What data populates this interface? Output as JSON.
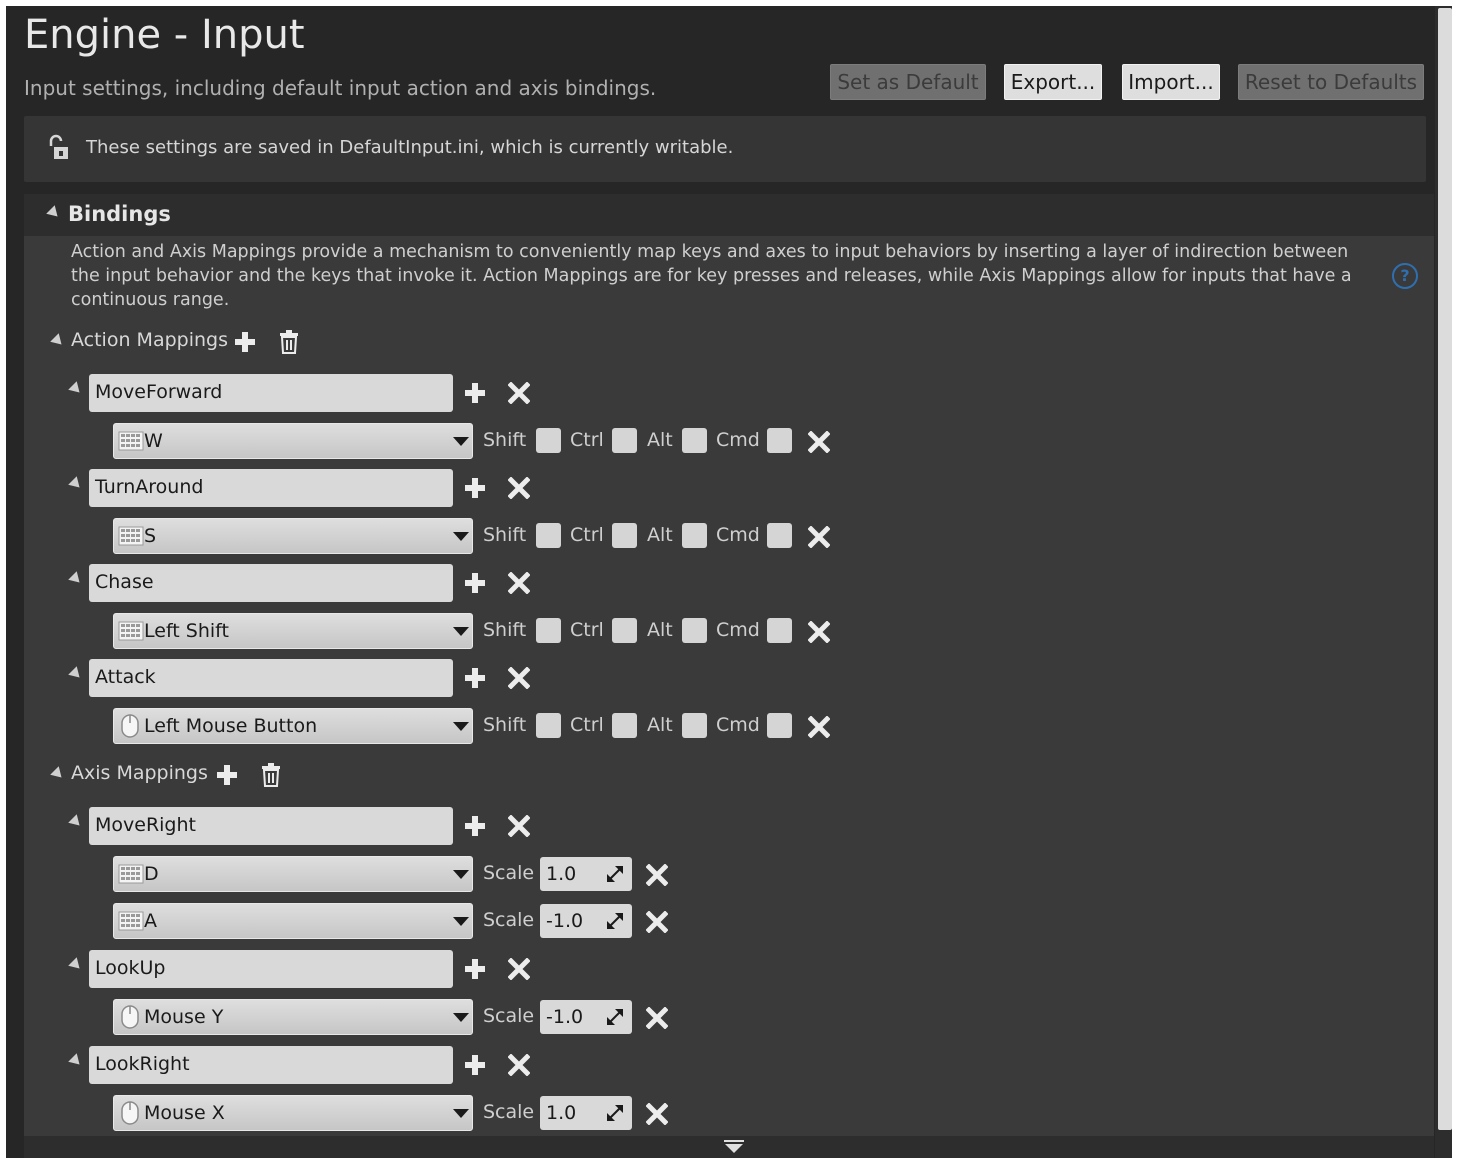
{
  "header": {
    "title": "Engine - Input",
    "subtitle": "Input settings, including default input action and axis bindings."
  },
  "toolbar": {
    "set_default": "Set as Default",
    "export": "Export...",
    "import": "Import...",
    "reset": "Reset to Defaults"
  },
  "notice": {
    "text": "These settings are saved in DefaultInput.ini, which is currently writable."
  },
  "bindings": {
    "title": "Bindings",
    "description": "Action and Axis Mappings provide a mechanism to conveniently map keys and axes to input behaviors by inserting a layer of indirection between the input behavior and the keys that invoke it. Action Mappings are for key presses and releases, while Axis Mappings allow for inputs that have a continuous range.",
    "help_icon": "?"
  },
  "modifiers": {
    "shift": "Shift",
    "ctrl": "Ctrl",
    "alt": "Alt",
    "cmd": "Cmd"
  },
  "action_mappings": {
    "label": "Action Mappings",
    "items": [
      {
        "name": "MoveForward",
        "key": "W",
        "key_icon": "keyboard-icon",
        "shift": false,
        "ctrl": false,
        "alt": false,
        "cmd": false
      },
      {
        "name": "TurnAround",
        "key": "S",
        "key_icon": "keyboard-icon",
        "shift": false,
        "ctrl": false,
        "alt": false,
        "cmd": false
      },
      {
        "name": "Chase",
        "key": "Left Shift",
        "key_icon": "keyboard-icon",
        "shift": false,
        "ctrl": false,
        "alt": false,
        "cmd": false
      },
      {
        "name": "Attack",
        "key": "Left Mouse Button",
        "key_icon": "mouse-icon",
        "shift": false,
        "ctrl": false,
        "alt": false,
        "cmd": false
      }
    ]
  },
  "axis_mappings": {
    "label": "Axis Mappings",
    "scale_label": "Scale",
    "items": [
      {
        "name": "MoveRight",
        "keys": [
          {
            "key": "D",
            "key_icon": "keyboard-icon",
            "scale": "1.0"
          },
          {
            "key": "A",
            "key_icon": "keyboard-icon",
            "scale": "-1.0"
          }
        ]
      },
      {
        "name": "LookUp",
        "keys": [
          {
            "key": "Mouse Y",
            "key_icon": "mouse-icon",
            "scale": "-1.0"
          }
        ]
      },
      {
        "name": "LookRight",
        "keys": [
          {
            "key": "Mouse X",
            "key_icon": "mouse-icon",
            "scale": "1.0"
          }
        ]
      }
    ]
  },
  "colors": {
    "background": "#262626",
    "panel": "#3a3a3a",
    "field": "#d9d9d9",
    "help_blue": "#2f6fb0"
  }
}
